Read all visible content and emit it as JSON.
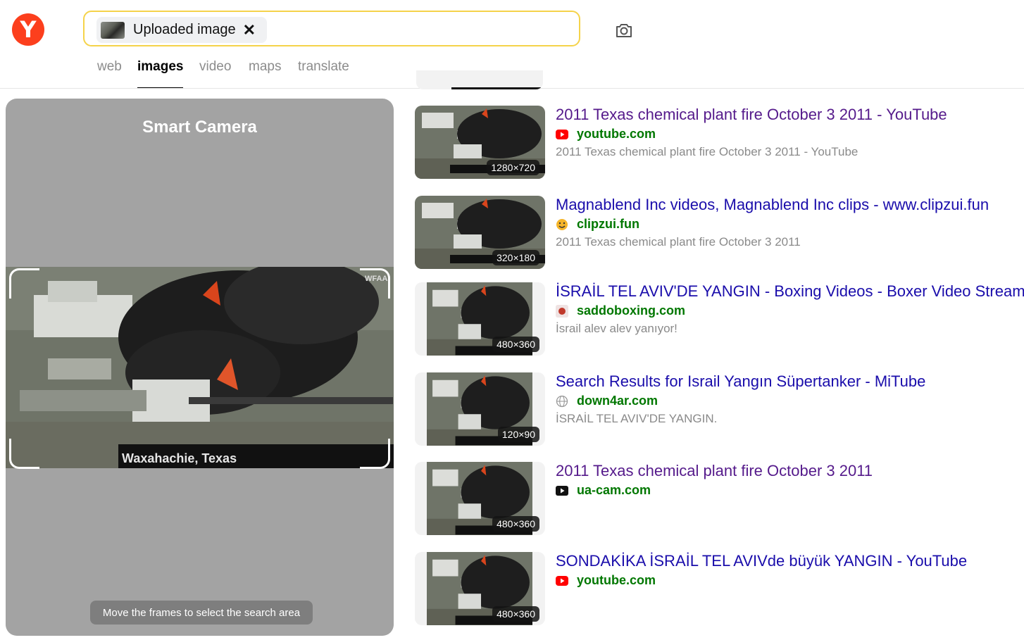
{
  "search": {
    "chip_label": "Uploaded image",
    "chip_close": "✕"
  },
  "nav_tabs": [
    {
      "label": "web",
      "active": false
    },
    {
      "label": "images",
      "active": true
    },
    {
      "label": "video",
      "active": false
    },
    {
      "label": "maps",
      "active": false
    },
    {
      "label": "translate",
      "active": false
    }
  ],
  "logo": {
    "letter": "Y"
  },
  "smart_camera": {
    "title": "Smart Camera",
    "preview_caption": "Waxahachie, Texas",
    "preview_watermark": "WFAA",
    "hint": "Move the frames to select the search area"
  },
  "results": [
    {
      "title": "2011 Texas chemical plant fire October 3 2011 - YouTube",
      "visited": true,
      "domain": "youtube.com",
      "favicon": "youtube-icon",
      "description": "2011 Texas chemical plant fire October 3 2011 - YouTube",
      "dimensions": "1280×720"
    },
    {
      "title": "Magnablend Inc videos, Magnablend Inc clips - www.clipzui.fun",
      "visited": false,
      "domain": "clipzui.fun",
      "favicon": "smiley-icon",
      "description": "2011 Texas chemical plant fire October 3 2011",
      "dimensions": "320×180"
    },
    {
      "title": "İSRAİL TEL AVIV'DE YANGIN - Boxing Videos - Boxer Video Stream",
      "visited": false,
      "domain": "saddoboxing.com",
      "favicon": "boxing-glove-icon",
      "description": "İsrail alev alev yanıyor!",
      "dimensions": "480×360"
    },
    {
      "title": "Search Results for Israil Yangın Süpertanker - MiTube",
      "visited": false,
      "domain": "down4ar.com",
      "favicon": "globe-icon",
      "description": "İSRAİL TEL AVIV'DE YANGIN.",
      "dimensions": "120×90"
    },
    {
      "title": "2011 Texas chemical plant fire October 3 2011",
      "visited": true,
      "domain": "ua-cam.com",
      "favicon": "play-icon",
      "description": "",
      "dimensions": "480×360"
    },
    {
      "title": "SONDAKİKA İSRAİL TEL AVIVde büyük YANGIN - YouTube",
      "visited": false,
      "domain": "youtube.com",
      "favicon": "youtube-icon",
      "description": "",
      "dimensions": "480×360"
    }
  ]
}
